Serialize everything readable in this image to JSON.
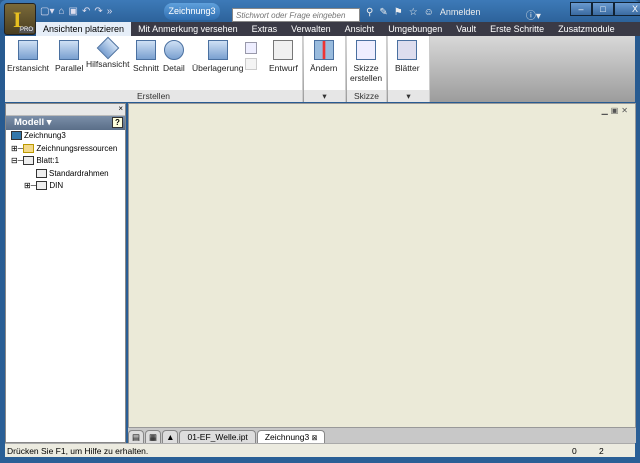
{
  "app": {
    "edition": "PRO",
    "document_title": "Zeichnung3"
  },
  "search": {
    "placeholder": "Stichwort oder Frage eingeben"
  },
  "header": {
    "signin": "Anmelden"
  },
  "tabs": [
    "Ansichten platzieren",
    "Mit Anmerkung versehen",
    "Extras",
    "Verwalten",
    "Ansicht",
    "Umgebungen",
    "Vault",
    "Erste Schritte",
    "Zusatzmodule"
  ],
  "ribbon": {
    "erstellen": {
      "label": "Erstellen",
      "buttons": [
        "Erstansicht",
        "Parallel",
        "Hilfsansicht",
        "Schnitt",
        "Detail",
        "Überlagerung",
        "Entwurf"
      ]
    },
    "aendern": {
      "button": "Ändern"
    },
    "skizze": {
      "label": "Skizze",
      "button_line1": "Skizze",
      "button_line2": "erstellen"
    },
    "blaetter": {
      "button": "Blätter"
    }
  },
  "browser": {
    "title": "Modell",
    "tree": [
      "Zeichnung3",
      "Zeichnungsressourcen",
      "Blatt:1",
      "Standardrahmen",
      "DIN"
    ]
  },
  "doc_tabs": [
    "01-EF_Welle.ipt",
    "Zeichnung3"
  ],
  "status": {
    "text": "Drücken Sie F1, um Hilfe zu erhalten.",
    "val1": "0",
    "val2": "2"
  }
}
